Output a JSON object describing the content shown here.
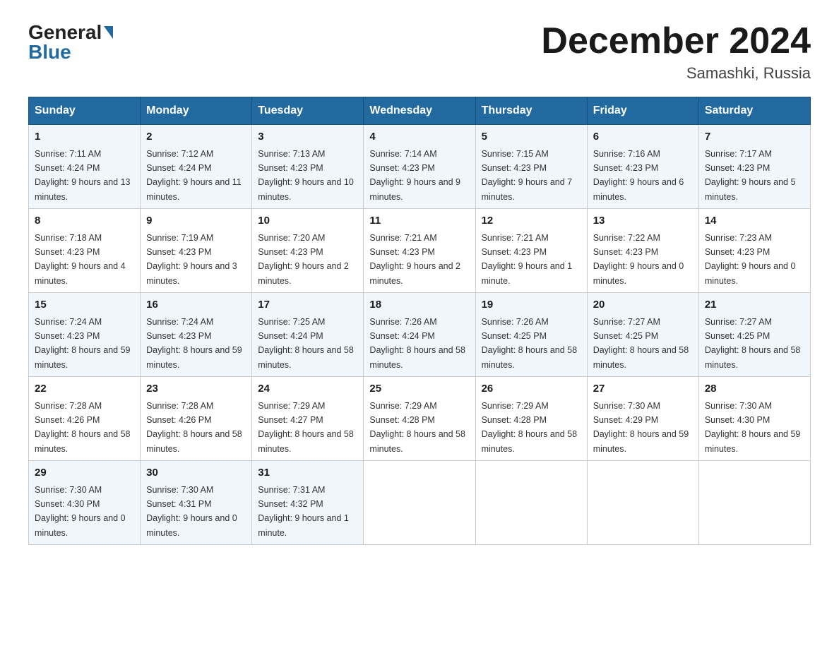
{
  "logo": {
    "line1": "General",
    "arrow": "▶",
    "line2": "Blue"
  },
  "title": {
    "month_year": "December 2024",
    "location": "Samashki, Russia"
  },
  "headers": [
    "Sunday",
    "Monday",
    "Tuesday",
    "Wednesday",
    "Thursday",
    "Friday",
    "Saturday"
  ],
  "weeks": [
    [
      {
        "day": "1",
        "sunrise": "7:11 AM",
        "sunset": "4:24 PM",
        "daylight": "9 hours and 13 minutes."
      },
      {
        "day": "2",
        "sunrise": "7:12 AM",
        "sunset": "4:24 PM",
        "daylight": "9 hours and 11 minutes."
      },
      {
        "day": "3",
        "sunrise": "7:13 AM",
        "sunset": "4:23 PM",
        "daylight": "9 hours and 10 minutes."
      },
      {
        "day": "4",
        "sunrise": "7:14 AM",
        "sunset": "4:23 PM",
        "daylight": "9 hours and 9 minutes."
      },
      {
        "day": "5",
        "sunrise": "7:15 AM",
        "sunset": "4:23 PM",
        "daylight": "9 hours and 7 minutes."
      },
      {
        "day": "6",
        "sunrise": "7:16 AM",
        "sunset": "4:23 PM",
        "daylight": "9 hours and 6 minutes."
      },
      {
        "day": "7",
        "sunrise": "7:17 AM",
        "sunset": "4:23 PM",
        "daylight": "9 hours and 5 minutes."
      }
    ],
    [
      {
        "day": "8",
        "sunrise": "7:18 AM",
        "sunset": "4:23 PM",
        "daylight": "9 hours and 4 minutes."
      },
      {
        "day": "9",
        "sunrise": "7:19 AM",
        "sunset": "4:23 PM",
        "daylight": "9 hours and 3 minutes."
      },
      {
        "day": "10",
        "sunrise": "7:20 AM",
        "sunset": "4:23 PM",
        "daylight": "9 hours and 2 minutes."
      },
      {
        "day": "11",
        "sunrise": "7:21 AM",
        "sunset": "4:23 PM",
        "daylight": "9 hours and 2 minutes."
      },
      {
        "day": "12",
        "sunrise": "7:21 AM",
        "sunset": "4:23 PM",
        "daylight": "9 hours and 1 minute."
      },
      {
        "day": "13",
        "sunrise": "7:22 AM",
        "sunset": "4:23 PM",
        "daylight": "9 hours and 0 minutes."
      },
      {
        "day": "14",
        "sunrise": "7:23 AM",
        "sunset": "4:23 PM",
        "daylight": "9 hours and 0 minutes."
      }
    ],
    [
      {
        "day": "15",
        "sunrise": "7:24 AM",
        "sunset": "4:23 PM",
        "daylight": "8 hours and 59 minutes."
      },
      {
        "day": "16",
        "sunrise": "7:24 AM",
        "sunset": "4:23 PM",
        "daylight": "8 hours and 59 minutes."
      },
      {
        "day": "17",
        "sunrise": "7:25 AM",
        "sunset": "4:24 PM",
        "daylight": "8 hours and 58 minutes."
      },
      {
        "day": "18",
        "sunrise": "7:26 AM",
        "sunset": "4:24 PM",
        "daylight": "8 hours and 58 minutes."
      },
      {
        "day": "19",
        "sunrise": "7:26 AM",
        "sunset": "4:25 PM",
        "daylight": "8 hours and 58 minutes."
      },
      {
        "day": "20",
        "sunrise": "7:27 AM",
        "sunset": "4:25 PM",
        "daylight": "8 hours and 58 minutes."
      },
      {
        "day": "21",
        "sunrise": "7:27 AM",
        "sunset": "4:25 PM",
        "daylight": "8 hours and 58 minutes."
      }
    ],
    [
      {
        "day": "22",
        "sunrise": "7:28 AM",
        "sunset": "4:26 PM",
        "daylight": "8 hours and 58 minutes."
      },
      {
        "day": "23",
        "sunrise": "7:28 AM",
        "sunset": "4:26 PM",
        "daylight": "8 hours and 58 minutes."
      },
      {
        "day": "24",
        "sunrise": "7:29 AM",
        "sunset": "4:27 PM",
        "daylight": "8 hours and 58 minutes."
      },
      {
        "day": "25",
        "sunrise": "7:29 AM",
        "sunset": "4:28 PM",
        "daylight": "8 hours and 58 minutes."
      },
      {
        "day": "26",
        "sunrise": "7:29 AM",
        "sunset": "4:28 PM",
        "daylight": "8 hours and 58 minutes."
      },
      {
        "day": "27",
        "sunrise": "7:30 AM",
        "sunset": "4:29 PM",
        "daylight": "8 hours and 59 minutes."
      },
      {
        "day": "28",
        "sunrise": "7:30 AM",
        "sunset": "4:30 PM",
        "daylight": "8 hours and 59 minutes."
      }
    ],
    [
      {
        "day": "29",
        "sunrise": "7:30 AM",
        "sunset": "4:30 PM",
        "daylight": "9 hours and 0 minutes."
      },
      {
        "day": "30",
        "sunrise": "7:30 AM",
        "sunset": "4:31 PM",
        "daylight": "9 hours and 0 minutes."
      },
      {
        "day": "31",
        "sunrise": "7:31 AM",
        "sunset": "4:32 PM",
        "daylight": "9 hours and 1 minute."
      },
      null,
      null,
      null,
      null
    ]
  ]
}
